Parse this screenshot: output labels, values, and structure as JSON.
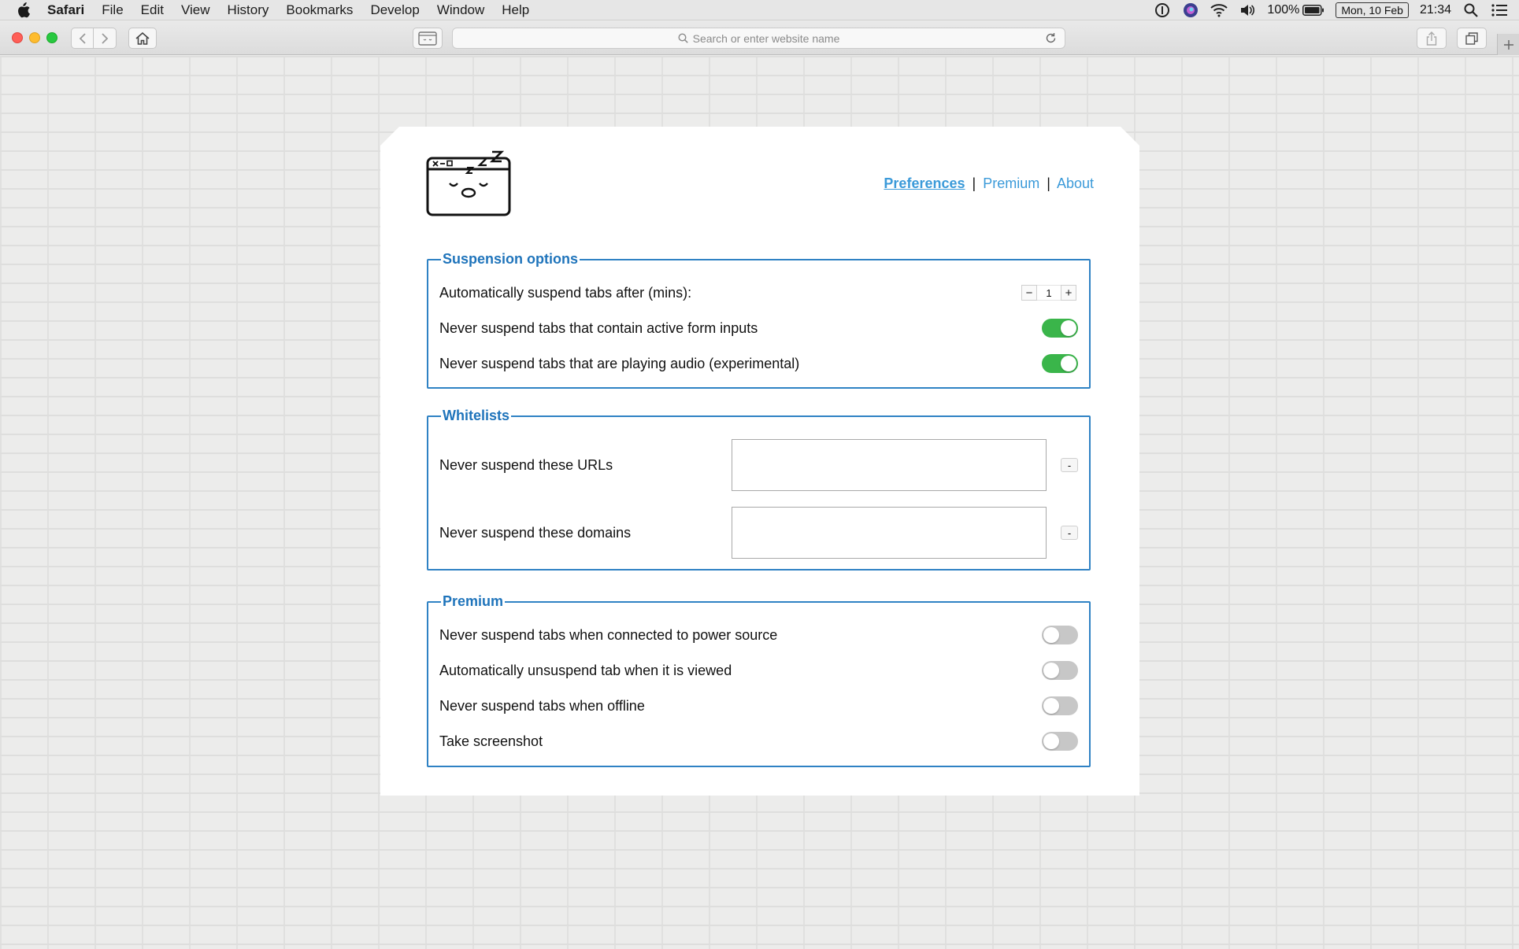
{
  "menubar": {
    "app_name": "Safari",
    "items": [
      "File",
      "Edit",
      "View",
      "History",
      "Bookmarks",
      "Develop",
      "Window",
      "Help"
    ],
    "battery_percent": "100%",
    "date": "Mon, 10 Feb",
    "time": "21:34"
  },
  "toolbar": {
    "address_placeholder": "Search or enter website name"
  },
  "header": {
    "links": [
      {
        "label": "Preferences",
        "active": true
      },
      {
        "label": "Premium",
        "active": false
      },
      {
        "label": "About",
        "active": false
      }
    ],
    "separator": "|"
  },
  "suspension": {
    "legend": "Suspension options",
    "suspend_after_label": "Automatically suspend tabs after (mins):",
    "suspend_after_value": "1",
    "stepper_minus": "−",
    "stepper_plus": "+",
    "form_inputs_label": "Never suspend tabs that contain active form inputs",
    "form_inputs_on": true,
    "audio_label": "Never suspend tabs that are playing audio (experimental)",
    "audio_on": true
  },
  "whitelists": {
    "legend": "Whitelists",
    "urls_label": "Never suspend these URLs",
    "urls_value": "",
    "domains_label": "Never suspend these domains",
    "domains_value": "",
    "remove_label": "-"
  },
  "premium": {
    "legend": "Premium",
    "power_label": "Never suspend tabs when connected to power source",
    "power_on": false,
    "unsuspend_label": "Automatically unsuspend tab when it is viewed",
    "unsuspend_on": false,
    "offline_label": "Never suspend tabs when offline",
    "offline_on": false,
    "screenshot_label": "Take screenshot",
    "screenshot_on": false
  },
  "colors": {
    "accent_blue": "#2f82c4",
    "link_blue": "#3b9ad9",
    "toggle_on": "#3ab54a",
    "toggle_off": "#c7c7c7"
  }
}
